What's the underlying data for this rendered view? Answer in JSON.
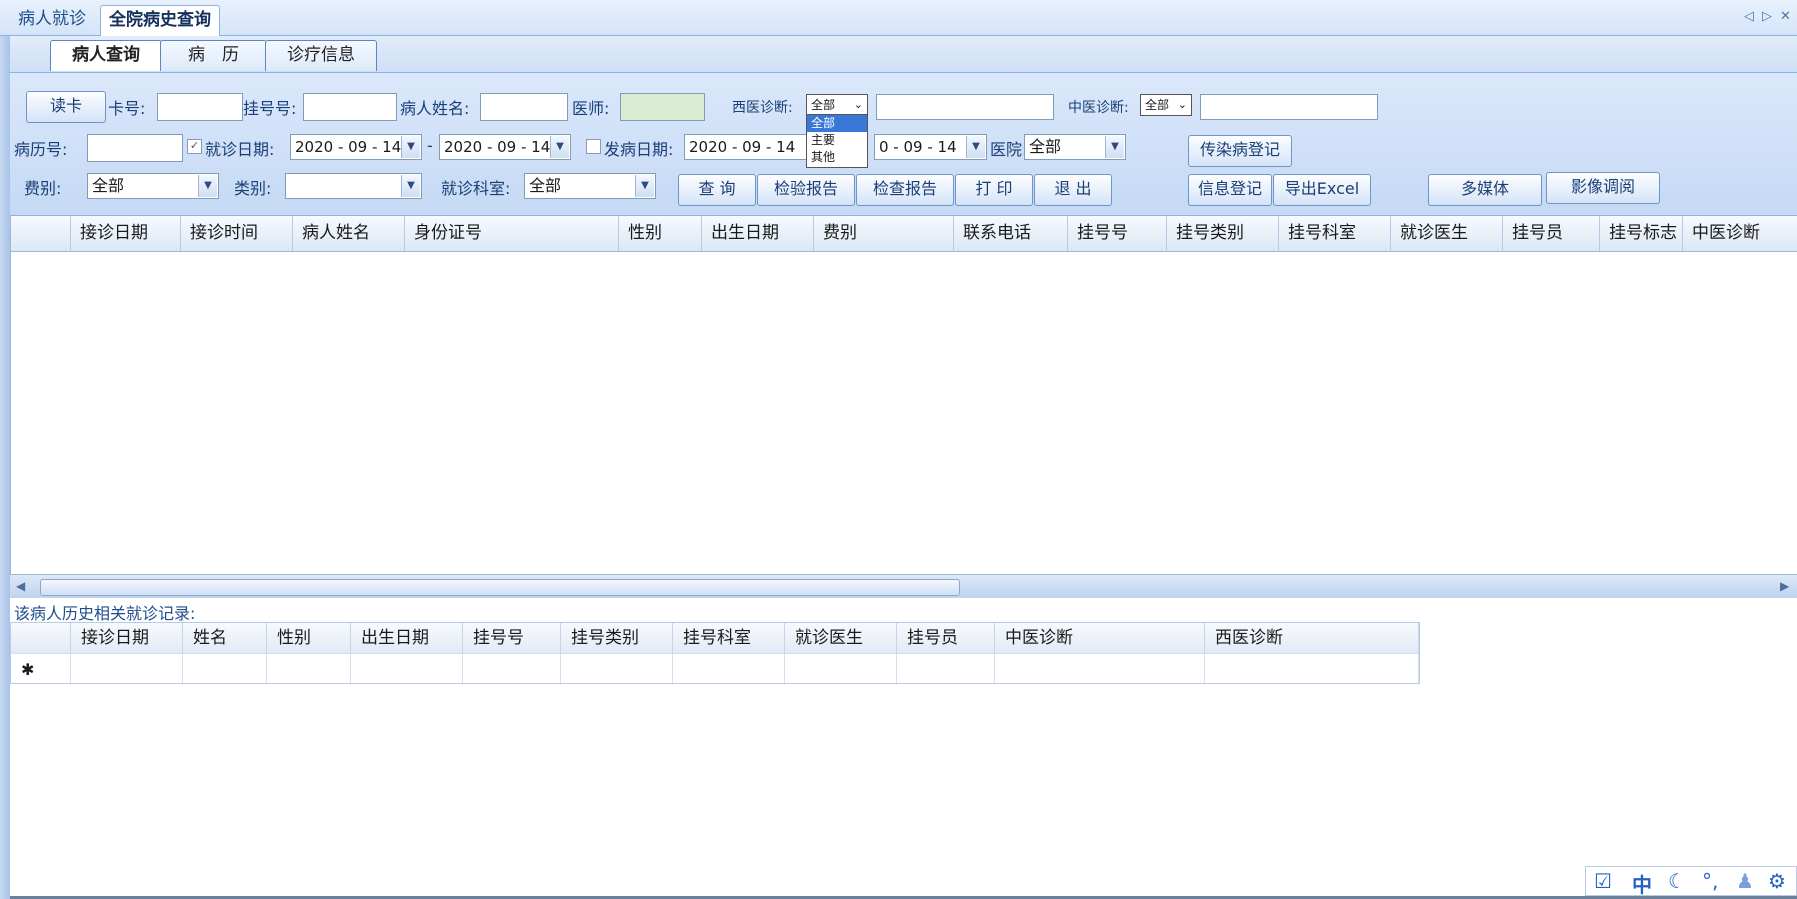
{
  "doc_tabs": {
    "tab1": "病人就诊",
    "tab2": "全院病史查询"
  },
  "window_controls": {
    "prev": "◁",
    "next": "▷",
    "close": "✕"
  },
  "inner_tabs": [
    "病人查询",
    "病　历",
    "诊疗信息"
  ],
  "query": {
    "read_card_btn": "读卡",
    "card_no_label": "卡号:",
    "reg_no_label": "挂号号:",
    "patient_name_label": "病人姓名:",
    "doctor_label": "医师:",
    "west_diag_label": "西医诊断:",
    "west_diag_select": "全部",
    "west_diag_options": [
      "全部",
      "主要",
      "其他"
    ],
    "tcm_diag_label": "中医诊断:",
    "tcm_diag_select": "全部",
    "record_no_label": "病历号:",
    "visit_date_label": "就诊日期:",
    "visit_date_from": "2020 - 09 - 14",
    "date_sep": "-",
    "visit_date_to": "2020 - 09 - 14",
    "onset_date_label": "发病日期:",
    "onset_date_from": "2020 - 09 - 14",
    "onset_date_to_visible": "0 - 09 - 14",
    "hospital_label": "医院:",
    "hospital_value": "全部",
    "infect_btn": "传染病登记",
    "fee_label": "费别:",
    "fee_value": "全部",
    "category_label": "类别:",
    "category_value": "",
    "dept_label": "就诊科室:",
    "dept_value": "全部",
    "query_btn": "查 询",
    "lab_report_btn": "检验报告",
    "exam_report_btn": "检查报告",
    "print_btn": "打 印",
    "exit_btn": "退 出",
    "info_reg_btn": "信息登记",
    "export_btn": "导出Excel",
    "multimedia_btn": "多媒体",
    "image_btn": "影像调阅"
  },
  "main_grid": {
    "columns": [
      "接诊日期",
      "接诊时间",
      "病人姓名",
      "身份证号",
      "性别",
      "出生日期",
      "费别",
      "联系电话",
      "挂号号",
      "挂号类别",
      "挂号科室",
      "就诊医生",
      "挂号员",
      "挂号标志",
      "中医诊断"
    ]
  },
  "history": {
    "label": "该病人历史相关就诊记录:",
    "columns": [
      "接诊日期",
      "姓名",
      "性别",
      "出生日期",
      "挂号号",
      "挂号类别",
      "挂号科室",
      "就诊医生",
      "挂号员",
      "中医诊断",
      "西医诊断"
    ],
    "new_row_marker": "✱"
  },
  "tray_icons": [
    "edit-icon",
    "ime-chinese-icon",
    "moon-icon",
    "punctuation-icon",
    "user-icon",
    "settings-icon"
  ],
  "tray": {
    "ime": "中"
  }
}
